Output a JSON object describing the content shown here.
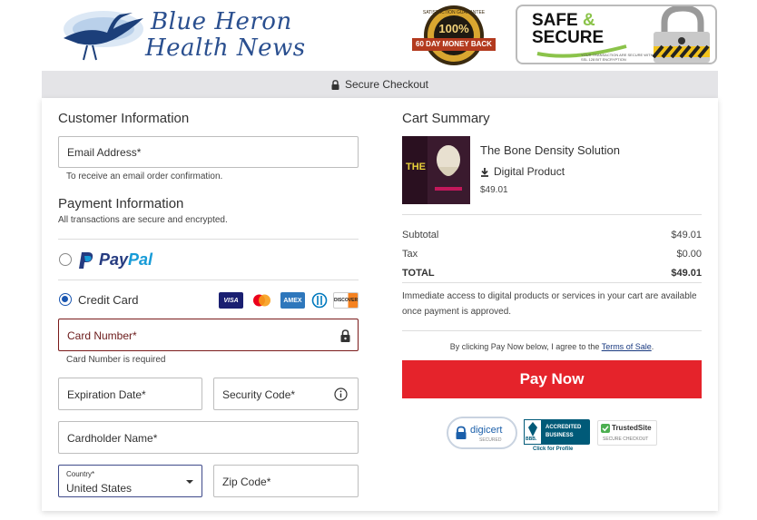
{
  "header": {
    "brand_line1": "Blue Heron",
    "brand_line2": "Health News",
    "guarantee_top": "SATISFACTION GUARANTEE",
    "guarantee_pct": "100%",
    "guarantee_text": "60 DAY MONEY BACK",
    "safe_line1": "SAFE",
    "safe_amp": "&",
    "safe_line2": "SECURE",
    "safe_sub": "YOUR TRANSACTION ARE SECURE WITH SSL 128 BIT ENCRYPTION"
  },
  "banner": {
    "text": "Secure Checkout"
  },
  "customer": {
    "title": "Customer Information",
    "email_label": "Email Address*",
    "email_hint": "To receive an email order confirmation."
  },
  "payment": {
    "title": "Payment Information",
    "subtitle": "All transactions are secure and encrypted.",
    "paypal_p1": "Pay",
    "paypal_p2": "Pal",
    "credit_label": "Credit Card",
    "card_brands": [
      "VISA",
      "mastercard",
      "AMEX",
      "diners",
      "DISCOVER"
    ],
    "card_number_label": "Card Number*",
    "card_number_error": "Card Number is required",
    "expiration_label": "Expiration Date*",
    "security_label": "Security Code*",
    "cardholder_label": "Cardholder Name*",
    "country_small": "Country*",
    "country_value": "United States",
    "zip_label": "Zip Code*"
  },
  "summary": {
    "title": "Cart Summary",
    "product_name": "The Bone Density Solution",
    "product_type": "Digital Product",
    "product_price": "$49.01",
    "product_thumb_text": "THE",
    "subtotal_label": "Subtotal",
    "subtotal_value": "$49.01",
    "tax_label": "Tax",
    "tax_value": "$0.00",
    "total_label": "TOTAL",
    "total_value": "$49.01",
    "notice": "Immediate access to digital products or services in your cart are available once payment is approved.",
    "terms_prefix": "By clicking Pay Now below, I agree to the",
    "terms_link": "Terms of Sale",
    "terms_suffix": ".",
    "pay_button": "Pay Now"
  },
  "trust": {
    "digicert": "digicert",
    "digicert_sub": "SECURED",
    "bbb_line1": "ACCREDITED",
    "bbb_line2": "BUSINESS",
    "bbb_click": "Click for Profile",
    "bbb_logo": "BBB.",
    "trusted": "TrustedSite",
    "trusted_sub": "SECURE CHECKOUT"
  },
  "colors": {
    "accent": "#1a56b0",
    "pay": "#e5232b",
    "error": "#7a1a1a",
    "brand": "#2a4f8f"
  }
}
